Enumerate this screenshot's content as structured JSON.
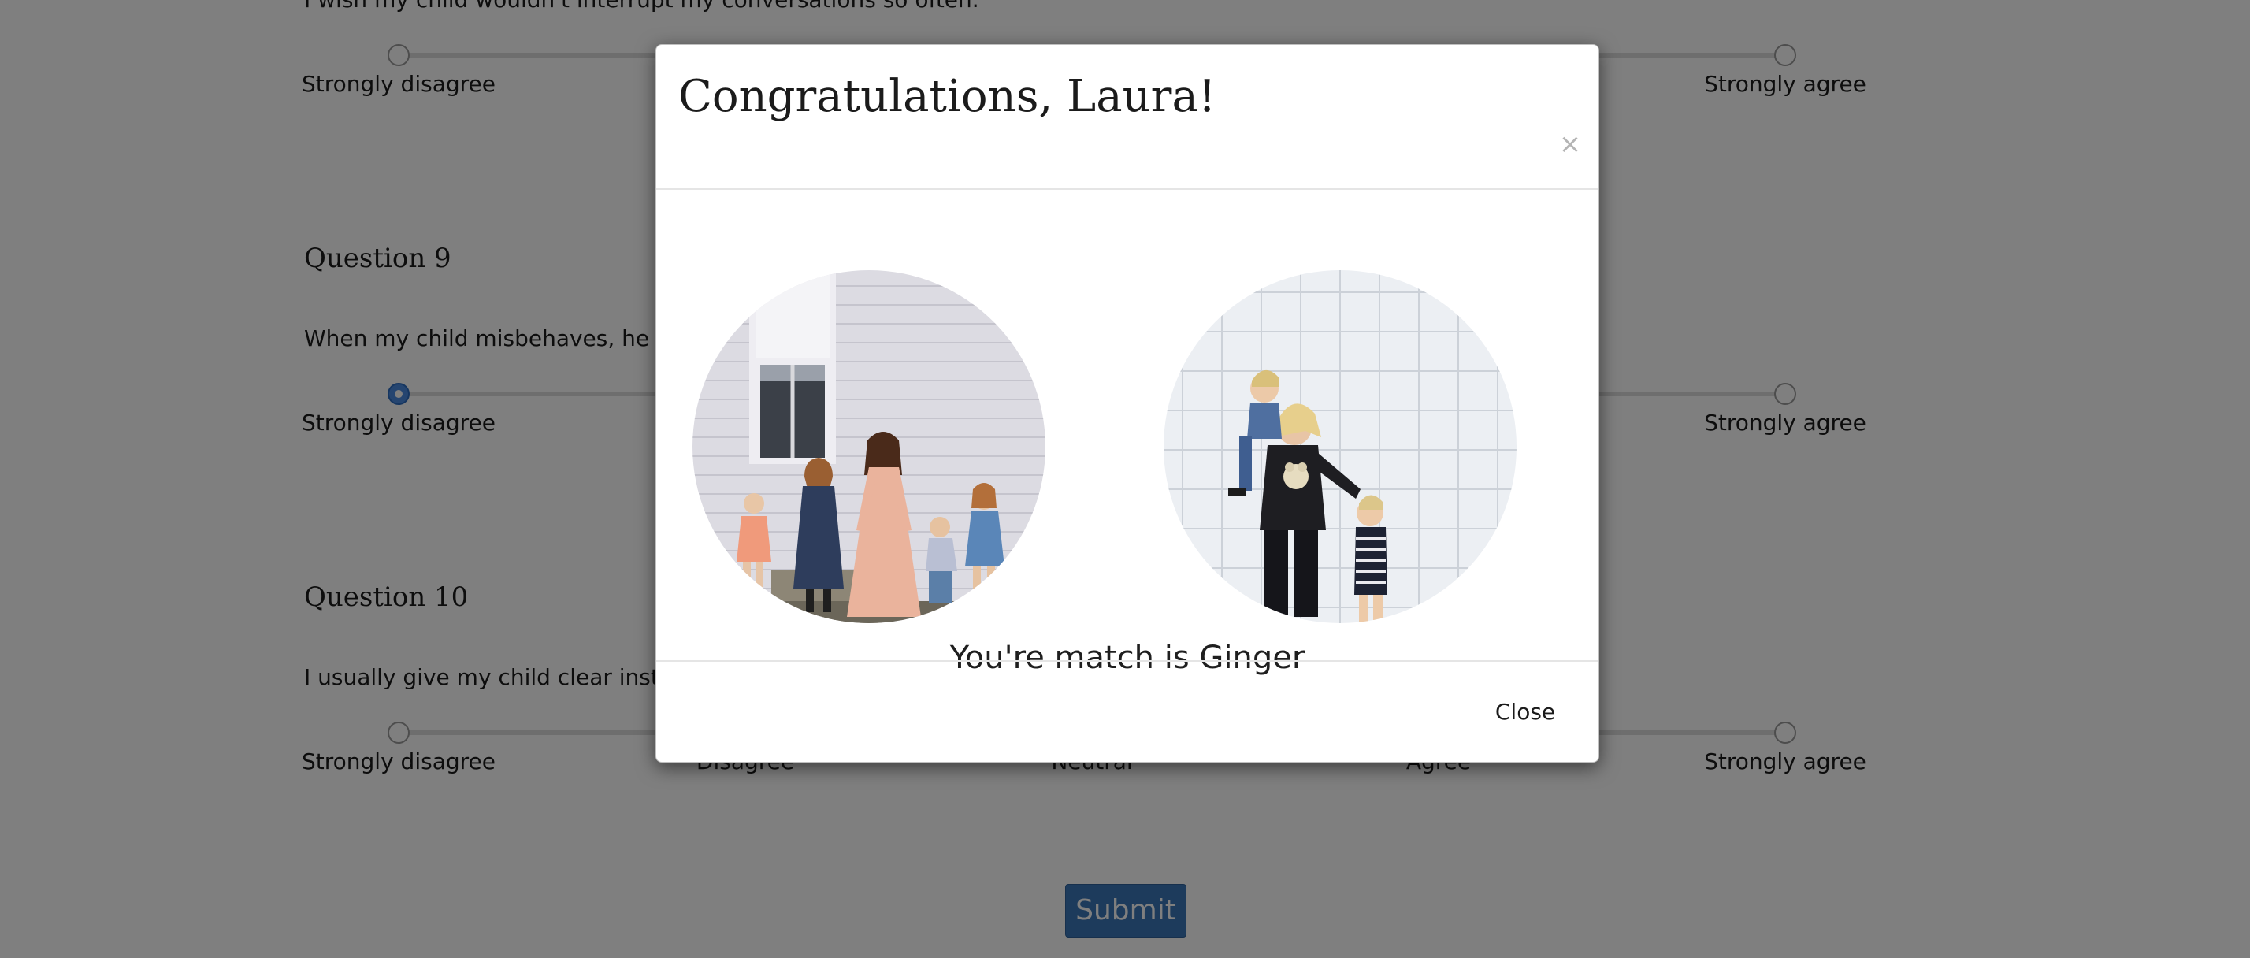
{
  "survey": {
    "partial_statement": "I wish my child wouldn't interrupt my conversations so often.",
    "scale_labels": [
      "Strongly disagree",
      "Disagree",
      "Neutral",
      "Agree",
      "Strongly agree"
    ],
    "questions": [
      {
        "title": "Question 9",
        "text": "When my child misbehaves, he or she knows what the consequences will be.",
        "selected_index": 0
      },
      {
        "title": "Question 10",
        "text": "I usually give my child clear instructions about what I expect.",
        "selected_index": null
      }
    ],
    "submit_label": "Submit"
  },
  "modal": {
    "title": "Congratulations, Laura!",
    "close_icon": "×",
    "match_text": "You're match is Ginger",
    "close_label": "Close",
    "photos": [
      {
        "icon": "family-photo-left",
        "description_name": "mother-with-four-children"
      },
      {
        "icon": "family-photo-right",
        "description_name": "mother-carrying-two-children"
      }
    ]
  },
  "colors": {
    "primary_button": "#3a77b8",
    "selected_radio": "#4a8ae0",
    "backdrop": "rgba(0,0,0,0.5)"
  }
}
